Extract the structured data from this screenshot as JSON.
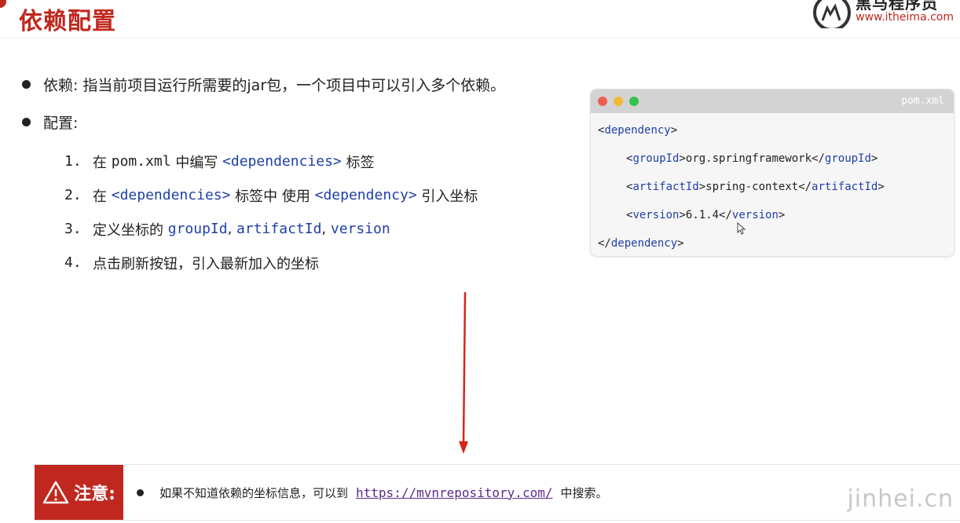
{
  "header": {
    "title": "依赖配置",
    "logo_name": "黑马程序员",
    "logo_url": "www.itheima.com"
  },
  "bullets": {
    "dependency_label": "依赖:",
    "dependency_desc": "指当前项目运行所需要的jar包，一个项目中可以引入多个依赖。",
    "config_label": "配置:"
  },
  "steps": [
    {
      "num": "1.",
      "pre": "在 ",
      "code1": "pom.xml",
      "mid": " 中编写 ",
      "code2": "<dependencies>",
      "post": " 标签"
    },
    {
      "num": "2.",
      "pre": "在 ",
      "code1": "<dependencies>",
      "mid": " 标签中 使用 ",
      "code2": "<dependency>",
      "post": " 引入坐标"
    },
    {
      "num": "3.",
      "pre": "定义坐标的 ",
      "code1": "groupId",
      "sep1": ", ",
      "code2": "artifactId",
      "sep2": ", ",
      "code3": "version"
    },
    {
      "num": "4.",
      "text": "点击刷新按钮，引入最新加入的坐标"
    }
  ],
  "code_window": {
    "filename": "pom.xml",
    "lines": {
      "open_tag": "dependency",
      "group_tag": "groupId",
      "group_value": "org.springframework",
      "artifact_tag": "artifactId",
      "artifact_value": "spring-context",
      "version_tag": "version",
      "version_value": "6.1.4",
      "close_tag": "dependency"
    }
  },
  "note": {
    "label": "注意:",
    "text_before": "如果不知道依赖的坐标信息，可以到",
    "link": "https://mvnrepository.com/",
    "text_after": "中搜索。"
  },
  "watermark": "jinhei.cn",
  "colors": {
    "brand_red": "#c0281f",
    "code_blue": "#1f3fa8",
    "link_purple": "#5a2a8a"
  }
}
